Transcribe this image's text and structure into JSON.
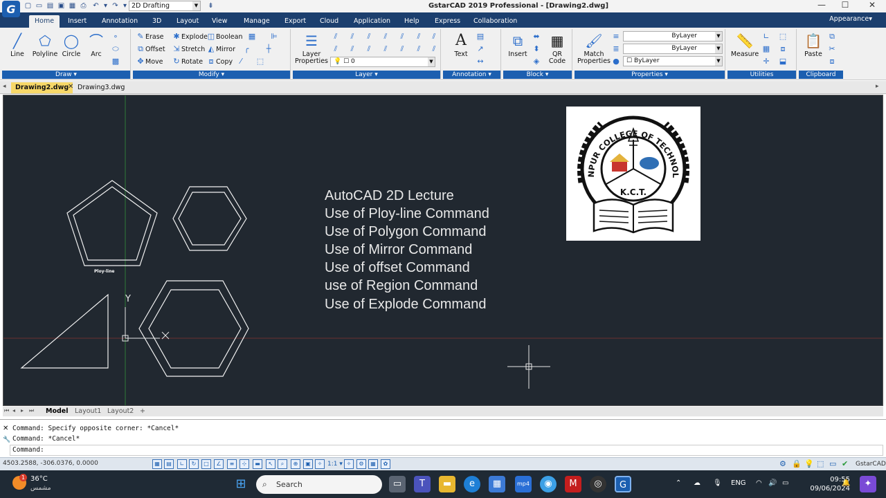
{
  "app": {
    "title": "GstarCAD 2019 Professional - [Drawing2.dwg]",
    "workspace": "2D Drafting",
    "logo_letter": "G"
  },
  "ribbon_tabs": [
    "Home",
    "Insert",
    "Annotation",
    "3D",
    "Layout",
    "View",
    "Manage",
    "Export",
    "Cloud",
    "Application",
    "Help",
    "Express",
    "Collaboration"
  ],
  "appearance": "Appearance",
  "draw_panel": {
    "title": "Draw",
    "buttons": [
      "Line",
      "Polyline",
      "Circle",
      "Arc"
    ]
  },
  "modify_panel": {
    "title": "Modify",
    "row1": [
      "Erase",
      "Explode",
      "Boolean"
    ],
    "row2": [
      "Offset",
      "Stretch",
      "Mirror"
    ],
    "row3": [
      "Move",
      "Rotate",
      "Copy"
    ]
  },
  "layer_panel": {
    "title": "Layer",
    "button": "Layer Properties",
    "current_layer": "0"
  },
  "annotation_panel": {
    "title": "Annotation",
    "button": "Text"
  },
  "block_panel": {
    "title": "Block",
    "buttons": [
      "Insert",
      "QR Code"
    ]
  },
  "properties_panel": {
    "title": "Properties",
    "button": "Match Properties",
    "line1": "ByLayer",
    "line2": "ByLayer",
    "color": "ByLayer"
  },
  "utilities_panel": {
    "title": "Utilities",
    "button": "Measure"
  },
  "clipboard_panel": {
    "title": "Clipboard",
    "button": "Paste"
  },
  "doc_tabs": [
    "Drawing2.dwg",
    "Drawing3.dwg"
  ],
  "canvas": {
    "lecture_lines": [
      "AutoCAD 2D Lecture",
      "Use of Ploy-line Command",
      "Use of Polygon Command",
      "Use of Mirror Command",
      "Use of offset Command",
      "use of Region Command",
      "Use of Explode Command"
    ],
    "shape_label": "Ploy-line",
    "ucs_y": "Y",
    "logo": {
      "name": "KHANPUR COLLEGE OF TECHNOLOGY",
      "abbr": "K.C.T."
    }
  },
  "layout_tabs": [
    "Model",
    "Layout1",
    "Layout2",
    "+"
  ],
  "command": {
    "history": [
      "Command: Specify opposite corner: *Cancel*",
      "Command: *Cancel*"
    ],
    "prompt": "Command:"
  },
  "status": {
    "coords": "4503.2588, -306.0376, 0.0000",
    "scale": "1:1",
    "brand": "GstarCAD"
  },
  "taskbar": {
    "temperature": "36°C",
    "weather_text": "مشمس",
    "search": "Search",
    "language": "ENG",
    "time": "09:55",
    "date": "09/06/2024",
    "notif_badge": "1"
  }
}
